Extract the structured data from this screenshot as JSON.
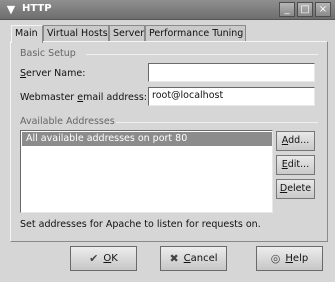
{
  "window": {
    "title": "HTTP"
  },
  "titlebar": {
    "menu_icon": "chevron-down-icon",
    "minimize": "_",
    "maximize": "□",
    "close": "×"
  },
  "tabs": [
    {
      "label": "Main",
      "active": true
    },
    {
      "label": "Virtual Hosts",
      "active": false
    },
    {
      "label": "Server",
      "active": false
    },
    {
      "label": "Performance Tuning",
      "active": false
    }
  ],
  "basic_setup": {
    "heading": "Basic Setup",
    "server_name": {
      "label_pre": "",
      "label_u": "S",
      "label_post": "erver Name:",
      "value": ""
    },
    "webmaster": {
      "label_pre": "Webmaster ",
      "label_u": "e",
      "label_post": "mail address:",
      "value": "root@localhost"
    }
  },
  "addresses": {
    "heading": "Available Addresses",
    "items": [
      "All available addresses on port 80"
    ],
    "add_u": "A",
    "add_rest": "dd...",
    "edit_u": "E",
    "edit_rest": "dit...",
    "delete_u": "D",
    "delete_rest": "elete",
    "hint": "Set addresses for Apache to listen for requests on."
  },
  "buttons": {
    "ok_u": "O",
    "ok_rest": "K",
    "cancel_u": "C",
    "cancel_rest": "ancel",
    "help_u": "H",
    "help_rest": "elp"
  }
}
